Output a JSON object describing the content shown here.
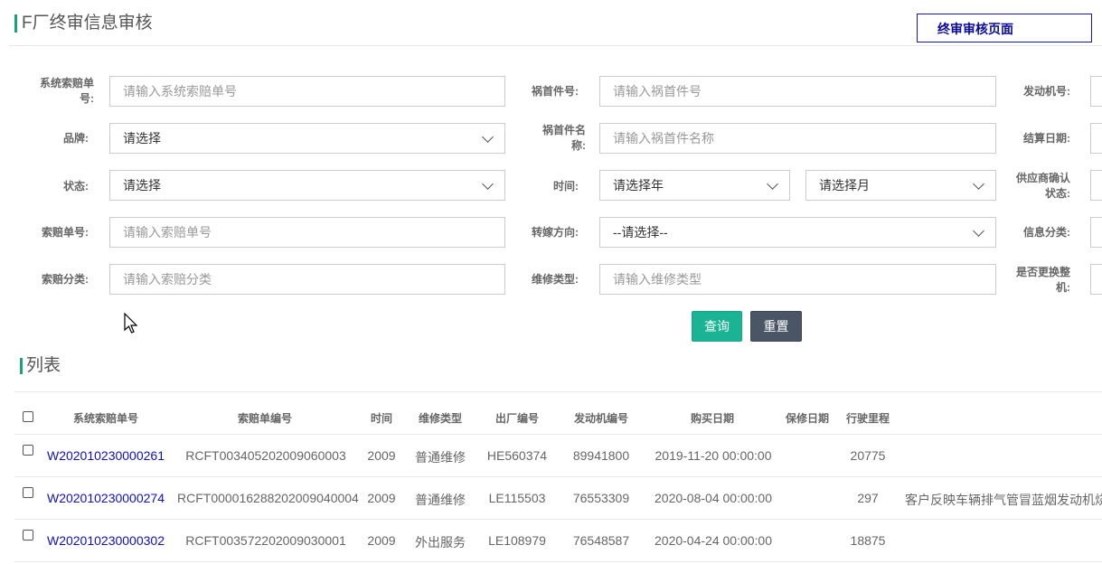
{
  "header": {
    "title": "F厂终审信息审核",
    "final_review_button": "终审审核页面"
  },
  "form": {
    "claim_sys_no_label": "系统索赔单号:",
    "claim_sys_no_placeholder": "请输入系统索赔单号",
    "culprit_part_no_label": "祸首件号:",
    "culprit_part_no_placeholder": "请输入祸首件号",
    "engine_no_label": "发动机号:",
    "brand_label": "品牌:",
    "brand_value": "请选择",
    "culprit_part_name_label": "祸首件名称:",
    "culprit_part_name_placeholder": "请输入祸首件名称",
    "settle_date_label": "结算日期:",
    "status_label": "状态:",
    "status_value": "请选择",
    "time_label": "时间:",
    "year_value": "请选择年",
    "month_value": "请选择月",
    "supplier_confirm_label": "供应商确认状态:",
    "claim_no_label": "索赔单号:",
    "claim_no_placeholder": "请输入索赔单号",
    "transfer_label": "转嫁方向:",
    "transfer_value": "--请选择--",
    "info_category_label": "信息分类:",
    "claim_category_label": "索赔分类:",
    "claim_category_placeholder": "请输入索赔分类",
    "repair_type_label": "维修类型:",
    "repair_type_placeholder": "请输入维修类型",
    "replace_whole_label": "是否更换整机:"
  },
  "actions": {
    "query": "查询",
    "reset": "重置"
  },
  "list": {
    "title": "列表",
    "columns": [
      "系统索赔单号",
      "索赔单编号",
      "时间",
      "维修类型",
      "出厂编号",
      "发动机编号",
      "购买日期",
      "保修日期",
      "行驶里程"
    ],
    "rows": [
      {
        "sys_no": "W202010230000261",
        "claim_no": "RCFT003405202009060003",
        "time": "2009",
        "repair": "普通维修",
        "factory_no": "HE560374",
        "engine_no": "89941800",
        "buy_date": "2019-11-20 00:00:00",
        "warranty": "",
        "mileage": "20775",
        "desc": ""
      },
      {
        "sys_no": "W202010230000274",
        "claim_no": "RCFT000016288202009040004",
        "time": "2009",
        "repair": "普通维修",
        "factory_no": "LE115503",
        "engine_no": "76553309",
        "buy_date": "2020-08-04 00:00:00",
        "warranty": "",
        "mileage": "297",
        "desc": "客户反映车辆排气管冒蓝烟发动机烧"
      },
      {
        "sys_no": "W202010230000302",
        "claim_no": "RCFT003572202009030001",
        "time": "2009",
        "repair": "外出服务",
        "factory_no": "LE108979",
        "engine_no": "76548587",
        "buy_date": "2020-04-24 00:00:00",
        "warranty": "",
        "mileage": "18875",
        "desc": ""
      }
    ]
  }
}
